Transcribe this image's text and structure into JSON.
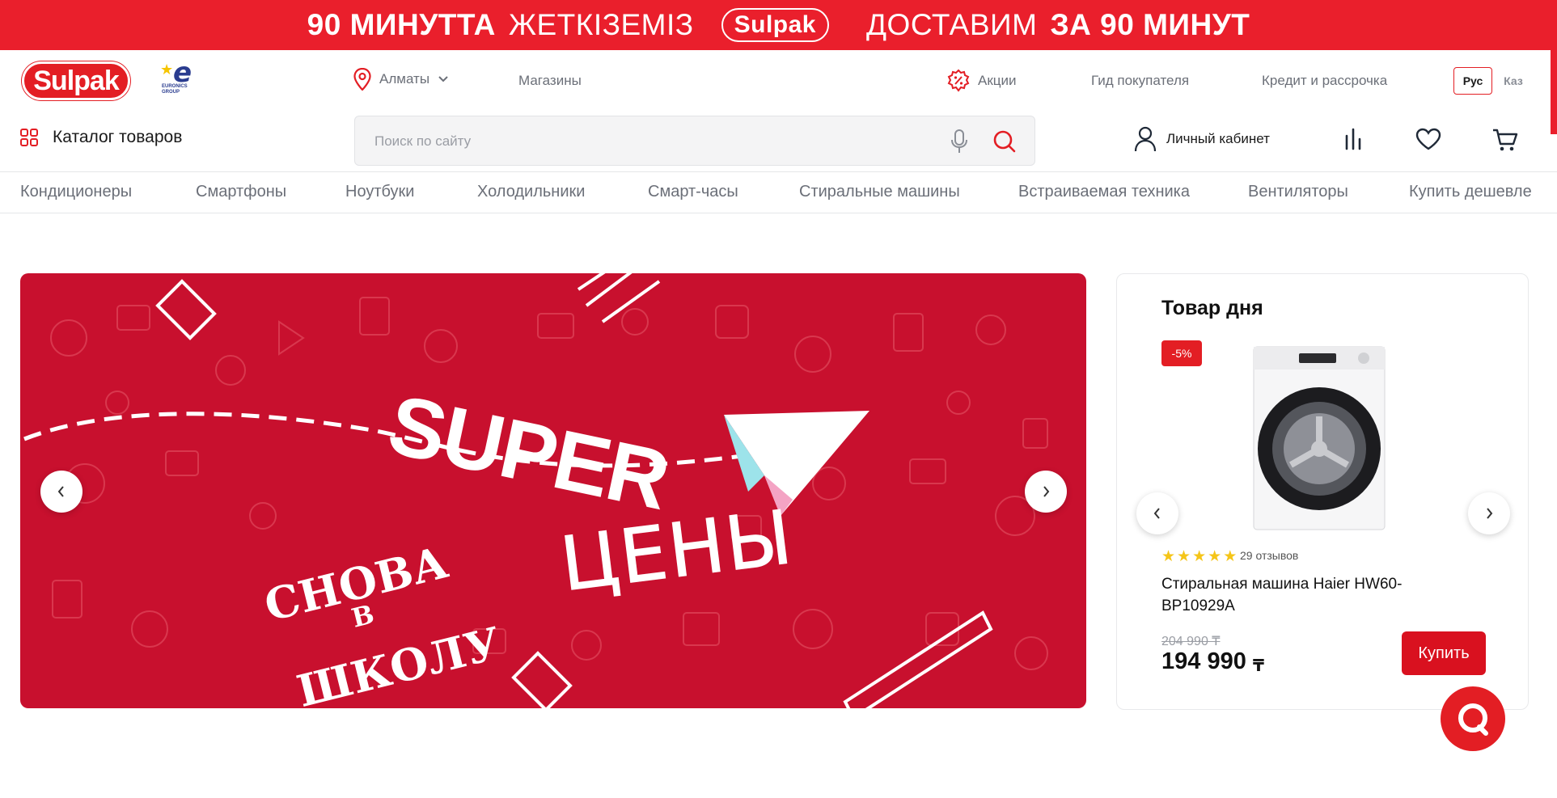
{
  "promo": {
    "part1": "90 МИНУТТА",
    "part2": "ЖЕТКІЗЕМІЗ",
    "logo": "Sulpak",
    "part3": "ДОСТАВИМ",
    "part4": "ЗА 90 МИНУТ"
  },
  "header": {
    "logo": "Sulpak",
    "partner": "EURONICS GROUP",
    "city": "Алматы",
    "stores": "Магазины",
    "promotions": "Акции",
    "buyer_guide": "Гид покупателя",
    "credit": "Кредит и рассрочка",
    "lang_ru": "Рус",
    "lang_kz": "Каз",
    "catalog": "Каталог товаров",
    "account": "Личный кабинет"
  },
  "search": {
    "placeholder": "Поиск по сайту"
  },
  "categories": [
    "Кондиционеры",
    "Смартфоны",
    "Ноутбуки",
    "Холодильники",
    "Смарт-часы",
    "Стиральные машины",
    "Встраиваемая техника",
    "Вентиляторы",
    "Купить дешевле"
  ],
  "hero": {
    "super": "SUPER",
    "prices": "ЦЕНЫ",
    "snova": "СНОВА",
    "v": "В",
    "shkolu": "ШКОЛУ",
    "bg_color": "#c8102e"
  },
  "deal": {
    "title": "Товар дня",
    "discount": "-5%",
    "rating": 5,
    "reviews": "29 отзывов",
    "name": "Стиральная машина Haier HW60-BP10929A",
    "old_price": "204 990 ₸",
    "price": "194 990",
    "currency": "₸",
    "buy_label": "Купить"
  },
  "colors": {
    "brand_red": "#e31e24",
    "text_muted": "#6b6f78"
  }
}
